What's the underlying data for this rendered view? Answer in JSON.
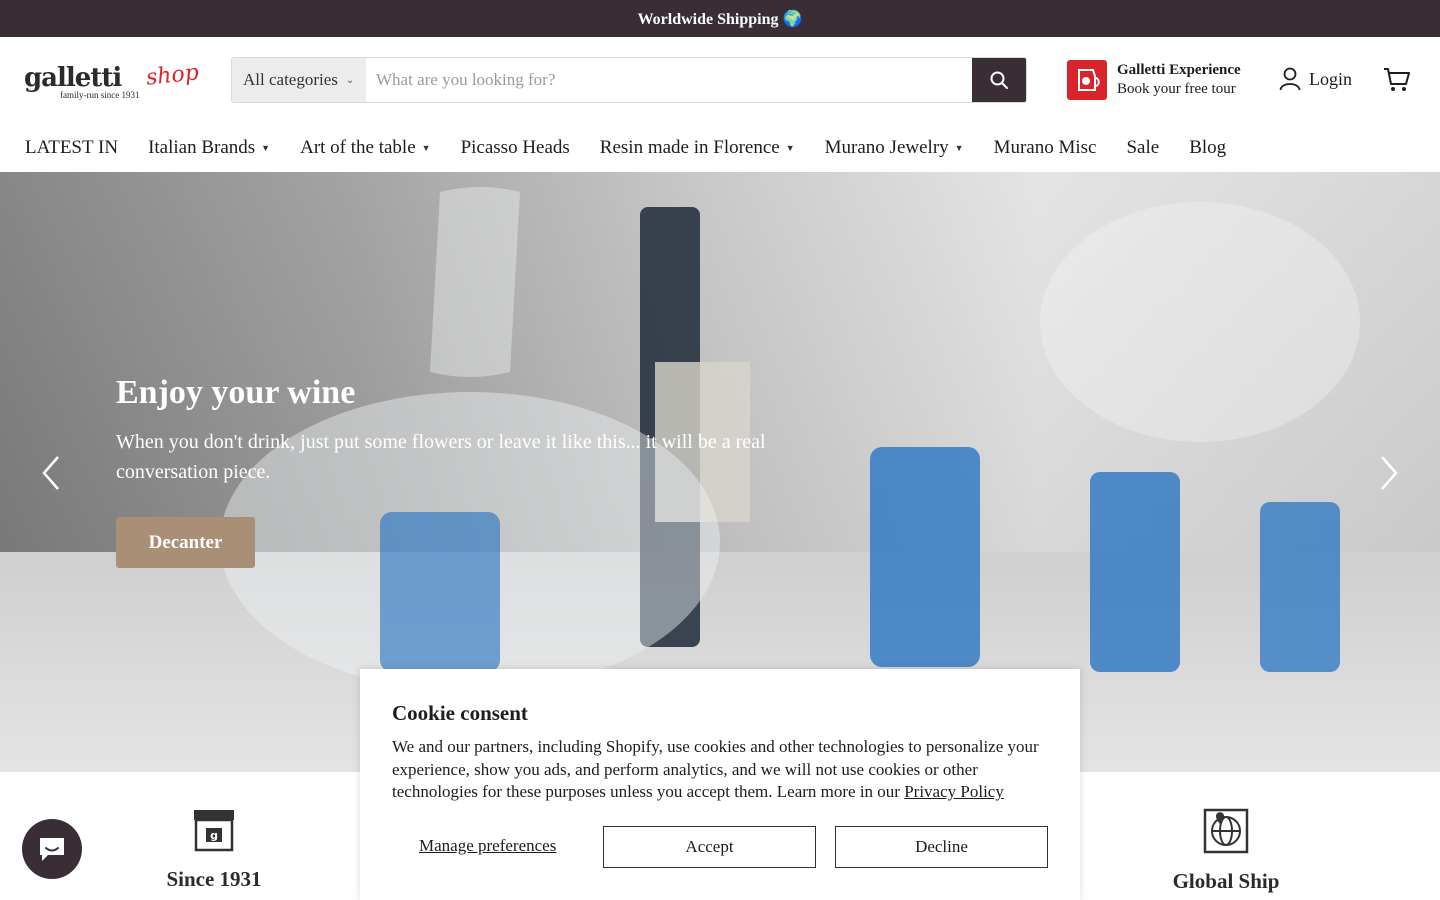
{
  "announcement": {
    "text": "Worldwide Shipping 🌍"
  },
  "header": {
    "logo": {
      "word": "galletti",
      "shop": "shop",
      "tagline": "family-run since 1931"
    },
    "search": {
      "category": "All categories",
      "placeholder": "What are you looking for?"
    },
    "experience": {
      "title": "Galletti Experience",
      "subtitle": "Book your free tour"
    },
    "login_label": "Login"
  },
  "nav": {
    "items": [
      {
        "label": "LATEST IN",
        "dropdown": false
      },
      {
        "label": "Italian Brands",
        "dropdown": true
      },
      {
        "label": "Art of the table",
        "dropdown": true
      },
      {
        "label": "Picasso Heads",
        "dropdown": false
      },
      {
        "label": "Resin made in Florence",
        "dropdown": true
      },
      {
        "label": "Murano Jewelry",
        "dropdown": true
      },
      {
        "label": "Murano Misc",
        "dropdown": false
      },
      {
        "label": "Sale",
        "dropdown": false
      },
      {
        "label": "Blog",
        "dropdown": false
      }
    ]
  },
  "hero": {
    "title": "Enjoy your wine",
    "subtitle": "When you don't drink, just put some flowers or leave it like this... it will be a real conversation piece.",
    "button_label": "Decanter"
  },
  "features": [
    {
      "title": "Since 1931",
      "icon": "shop-icon"
    },
    {
      "title": "Global Ship",
      "icon": "globe-location-icon"
    }
  ],
  "cookie": {
    "title": "Cookie consent",
    "body": "We and our partners, including Shopify, use cookies and other technologies to personalize your experience, show you ads, and perform analytics, and we will not use cookies or other technologies for these purposes unless you accept them. Learn more in our ",
    "link": "Privacy Policy",
    "manage_label": "Manage preferences",
    "accept_label": "Accept",
    "decline_label": "Decline"
  },
  "colors": {
    "brand_dark": "#3a2d36",
    "accent_red": "#d9242b",
    "hero_button": "#a88f75"
  }
}
